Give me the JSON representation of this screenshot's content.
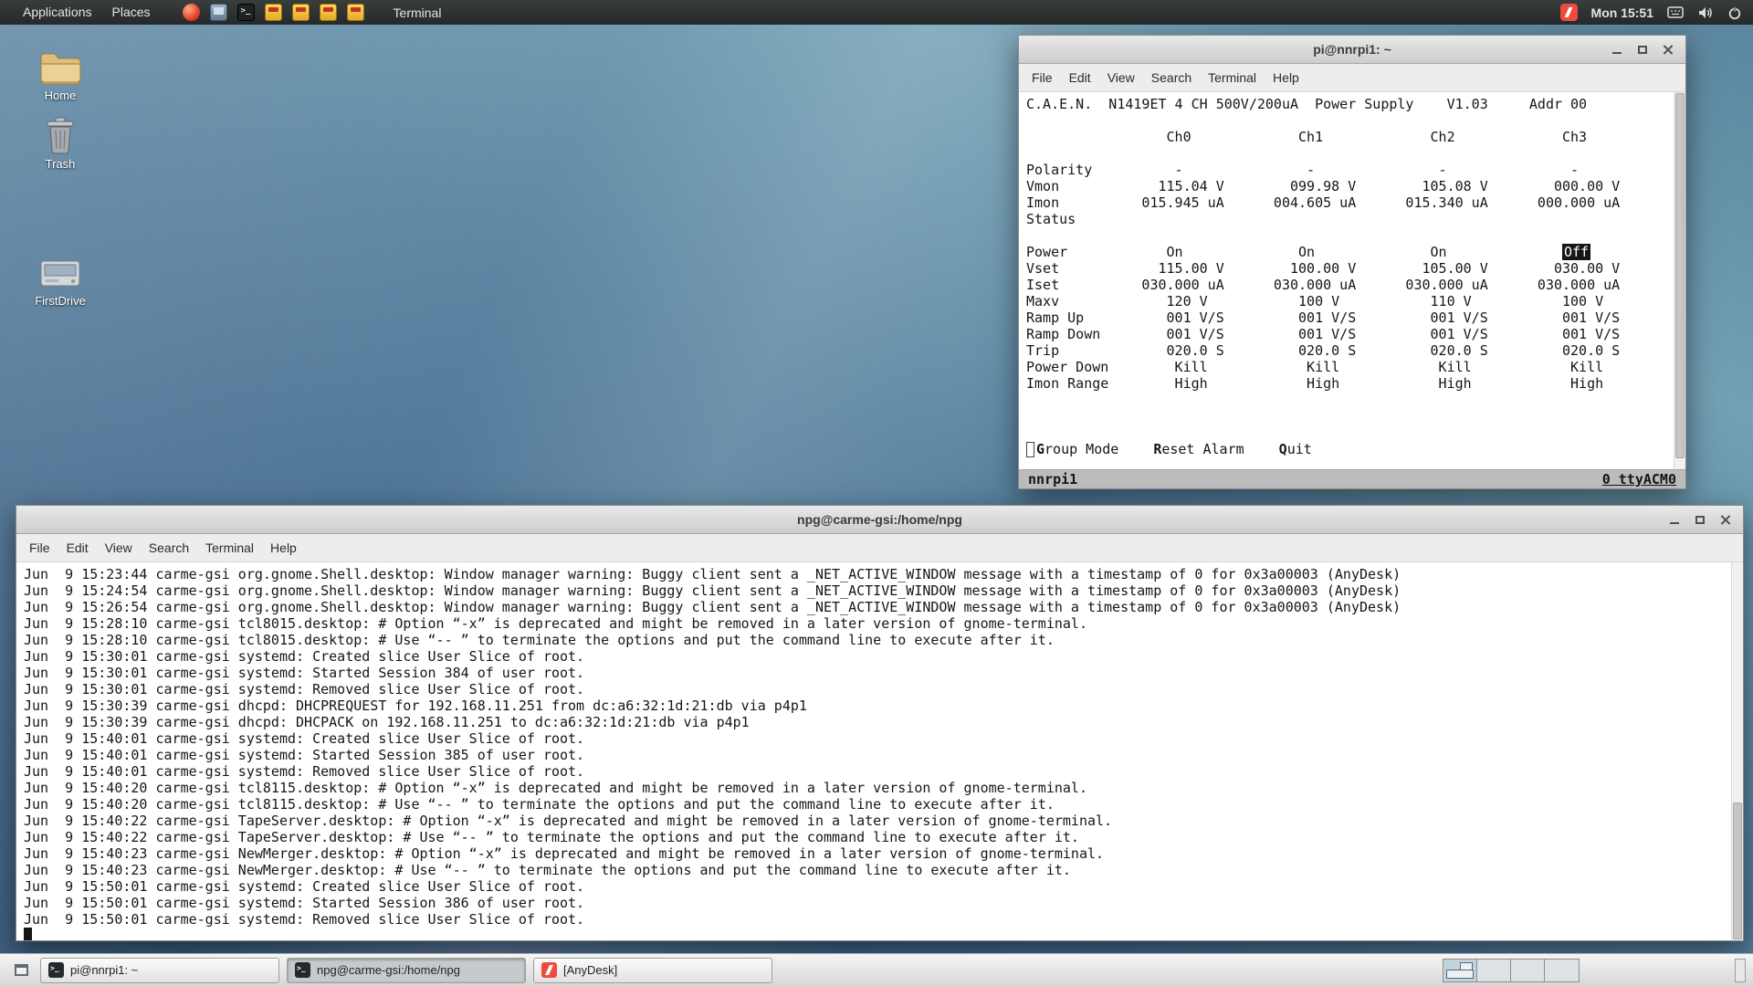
{
  "top_panel": {
    "menus": [
      "Applications",
      "Places"
    ],
    "launchers": [
      {
        "name": "red-orb-launcher-icon"
      },
      {
        "name": "files-launcher-icon"
      },
      {
        "name": "terminal-launcher-icon"
      },
      {
        "name": "yellow-app-launcher-icon-1"
      },
      {
        "name": "yellow-app-launcher-icon-2"
      },
      {
        "name": "yellow-app-launcher-icon-3"
      },
      {
        "name": "yellow-app-launcher-icon-4"
      }
    ],
    "launcher_label": "Terminal",
    "clock": "Mon 15:51"
  },
  "desktop": {
    "icons": [
      {
        "label": "Home"
      },
      {
        "label": "Trash"
      },
      {
        "label": "FirstDrive"
      }
    ]
  },
  "caen_window": {
    "title": "pi@nnrpi1: ~",
    "menu": [
      "File",
      "Edit",
      "View",
      "Search",
      "Terminal",
      "Help"
    ],
    "screen_lines": [
      "C.A.E.N.  N1419ET 4 CH 500V/200uA  Power Supply    V1.03     Addr 00",
      "",
      "                 Ch0             Ch1             Ch2             Ch3",
      "",
      "Polarity          -               -               -               -",
      "Vmon            115.04 V        099.98 V        105.08 V        000.00 V",
      "Imon          015.945 uA      004.605 uA      015.340 uA      000.000 uA",
      "Status",
      "",
      "Power            On              On              On              Off",
      "Vset            115.00 V        100.00 V        105.00 V        030.00 V",
      "Iset          030.000 uA      030.000 uA      030.000 uA      030.000 uA",
      "Maxv             120 V           100 V           110 V           100 V",
      "Ramp Up          001 V/S         001 V/S         001 V/S         001 V/S",
      "Ramp Down        001 V/S         001 V/S         001 V/S         001 V/S",
      "Trip             020.0 S         020.0 S         020.0 S         020.0 S",
      "Power Down        Kill            Kill            Kill            Kill",
      "Imon Range        High            High            High            High"
    ],
    "inverted_value": "Off",
    "actions": [
      "Group Mode",
      "Reset Alarm",
      "Quit"
    ],
    "status_left": "nnrpi1",
    "status_right": "0 ttyACM0"
  },
  "log_window": {
    "title": "npg@carme-gsi:/home/npg",
    "menu": [
      "File",
      "Edit",
      "View",
      "Search",
      "Terminal",
      "Help"
    ],
    "lines": [
      "Jun  9 15:23:44 carme-gsi org.gnome.Shell.desktop: Window manager warning: Buggy client sent a _NET_ACTIVE_WINDOW message with a timestamp of 0 for 0x3a00003 (AnyDesk)",
      "Jun  9 15:24:54 carme-gsi org.gnome.Shell.desktop: Window manager warning: Buggy client sent a _NET_ACTIVE_WINDOW message with a timestamp of 0 for 0x3a00003 (AnyDesk)",
      "Jun  9 15:26:54 carme-gsi org.gnome.Shell.desktop: Window manager warning: Buggy client sent a _NET_ACTIVE_WINDOW message with a timestamp of 0 for 0x3a00003 (AnyDesk)",
      "Jun  9 15:28:10 carme-gsi tcl8015.desktop: # Option “-x” is deprecated and might be removed in a later version of gnome-terminal.",
      "Jun  9 15:28:10 carme-gsi tcl8015.desktop: # Use “-- ” to terminate the options and put the command line to execute after it.",
      "Jun  9 15:30:01 carme-gsi systemd: Created slice User Slice of root.",
      "Jun  9 15:30:01 carme-gsi systemd: Started Session 384 of user root.",
      "Jun  9 15:30:01 carme-gsi systemd: Removed slice User Slice of root.",
      "Jun  9 15:30:39 carme-gsi dhcpd: DHCPREQUEST for 192.168.11.251 from dc:a6:32:1d:21:db via p4p1",
      "Jun  9 15:30:39 carme-gsi dhcpd: DHCPACK on 192.168.11.251 to dc:a6:32:1d:21:db via p4p1",
      "Jun  9 15:40:01 carme-gsi systemd: Created slice User Slice of root.",
      "Jun  9 15:40:01 carme-gsi systemd: Started Session 385 of user root.",
      "Jun  9 15:40:01 carme-gsi systemd: Removed slice User Slice of root.",
      "Jun  9 15:40:20 carme-gsi tcl8115.desktop: # Option “-x” is deprecated and might be removed in a later version of gnome-terminal.",
      "Jun  9 15:40:20 carme-gsi tcl8115.desktop: # Use “-- ” to terminate the options and put the command line to execute after it.",
      "Jun  9 15:40:22 carme-gsi TapeServer.desktop: # Option “-x” is deprecated and might be removed in a later version of gnome-terminal.",
      "Jun  9 15:40:22 carme-gsi TapeServer.desktop: # Use “-- ” to terminate the options and put the command line to execute after it.",
      "Jun  9 15:40:23 carme-gsi NewMerger.desktop: # Option “-x” is deprecated and might be removed in a later version of gnome-terminal.",
      "Jun  9 15:40:23 carme-gsi NewMerger.desktop: # Use “-- ” to terminate the options and put the command line to execute after it.",
      "Jun  9 15:50:01 carme-gsi systemd: Created slice User Slice of root.",
      "Jun  9 15:50:01 carme-gsi systemd: Started Session 386 of user root.",
      "Jun  9 15:50:01 carme-gsi systemd: Removed slice User Slice of root."
    ]
  },
  "taskbar": {
    "tasks": [
      {
        "label": "pi@nnrpi1: ~",
        "icon": "terminal",
        "active": false
      },
      {
        "label": "npg@carme-gsi:/home/npg",
        "icon": "terminal",
        "active": true
      },
      {
        "label": "[AnyDesk]",
        "icon": "anydesk",
        "active": false
      }
    ],
    "workspace_count": 4,
    "active_workspace": 1
  },
  "colors": {
    "panel_bg": "#2e3233",
    "terminal_bg": "#ffffff",
    "terminal_fg": "#161616",
    "anydesk_red": "#ee4b3e",
    "inverse_cell_bg": "#161616"
  }
}
